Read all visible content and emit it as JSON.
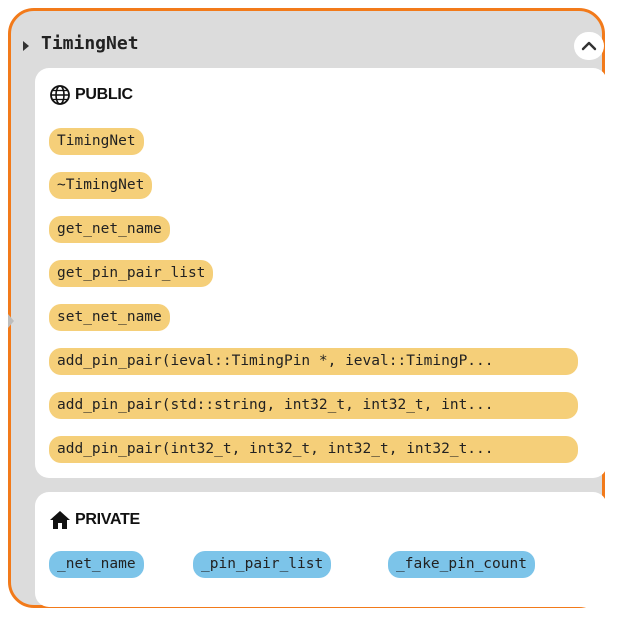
{
  "card": {
    "title": "TimingNet",
    "accent_color": "#f27a1a",
    "collapse_icon": "chevron-up-icon"
  },
  "public": {
    "label": "PUBLIC",
    "icon": "globe-icon",
    "color": "#f5cf79",
    "methods": [
      "TimingNet",
      "~TimingNet",
      "get_net_name",
      "get_pin_pair_list",
      "set_net_name",
      "add_pin_pair(ieval::TimingPin *, ieval::TimingP...",
      "add_pin_pair(std::string, int32_t, int32_t, int...",
      "add_pin_pair(int32_t, int32_t, int32_t, int32_t..."
    ]
  },
  "private": {
    "label": "PRIVATE",
    "icon": "home-icon",
    "color": "#7cc4e9",
    "fields": [
      "_net_name",
      "_pin_pair_list",
      "_fake_pin_count"
    ]
  }
}
